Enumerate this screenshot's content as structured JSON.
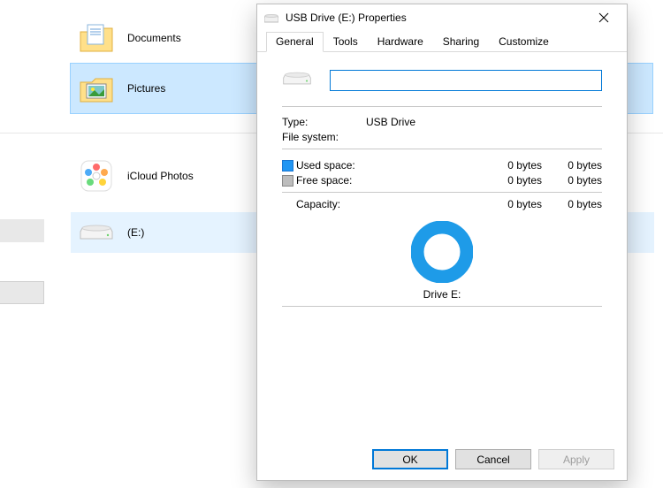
{
  "explorer": {
    "items_top": [
      {
        "label": "Documents",
        "icon": "folder-documents"
      },
      {
        "label": "Pictures",
        "icon": "folder-pictures"
      }
    ],
    "items_mid": [
      {
        "label": "iCloud Photos",
        "icon": "icloud-photos"
      }
    ],
    "drive": {
      "label": "(E:)",
      "icon": "drive"
    }
  },
  "dialog": {
    "title": "USB Drive (E:) Properties",
    "tabs": [
      "General",
      "Tools",
      "Hardware",
      "Sharing",
      "Customize"
    ],
    "active_tab": 0,
    "name_value": "",
    "type_label": "Type:",
    "type_value": "USB Drive",
    "fs_label": "File system:",
    "fs_value": "",
    "used_label": "Used space:",
    "used_bytes": "0 bytes",
    "used_human": "0 bytes",
    "free_label": "Free space:",
    "free_bytes": "0 bytes",
    "free_human": "0 bytes",
    "capacity_label": "Capacity:",
    "capacity_bytes": "0 bytes",
    "capacity_human": "0 bytes",
    "drive_caption": "Drive E:",
    "buttons": {
      "ok": "OK",
      "cancel": "Cancel",
      "apply": "Apply"
    }
  }
}
